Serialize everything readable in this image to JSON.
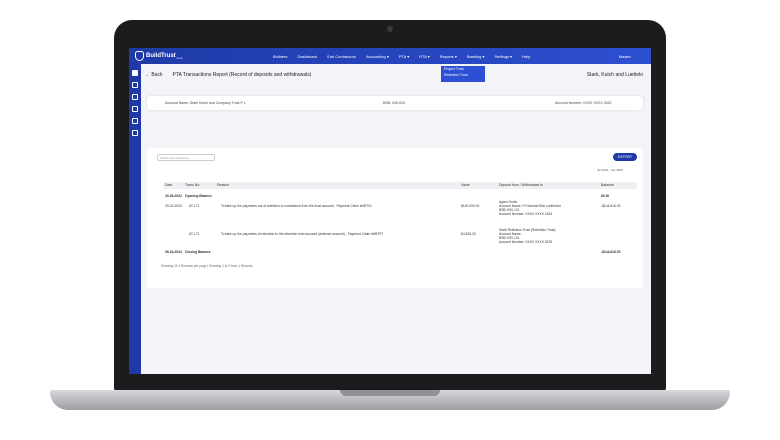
{
  "app": {
    "logo_text": "BuildTrust",
    "logo_sub": "beta",
    "nav": [
      "Builders",
      "Dashboard",
      "Sub Contractors",
      "Accounting ▾",
      "PTA ▾",
      "RTA ▾",
      "Reports ▾",
      "Banking ▾",
      "Settings ▾",
      "Help"
    ],
    "user": "Master"
  },
  "dropdown": [
    "Project Trust",
    "Retention Trust"
  ],
  "page": {
    "back": "← Back",
    "title": "PTA Transactions Report (Record of deposits and withdrawals)",
    "company": "Stark, Kutch and Luettelo"
  },
  "account": {
    "name": "Account Name: Stark Kutch and Company Trust P L",
    "bsb": "BSB: 000-034",
    "number": "Account Number: XXXX XXXX 3432"
  },
  "controls": {
    "select_placeholder": "Select Sub Contractor",
    "export": "EXPORT",
    "date_range": "Jul 2022 - Apr 2024"
  },
  "table": {
    "headers": [
      "Date",
      "Trans No.",
      "Reason",
      "Value",
      "Deposit from / Withdrawal to",
      "Balance"
    ],
    "opening": {
      "date": "30-06-2022",
      "label": "Opening Balance",
      "balance": "$0.00"
    },
    "rows": [
      {
        "date": "20-02-2024",
        "trans": "AT-171",
        "reason": "To take up the payments out of retention to contractors from the trust account - Payment Claim #HBT01",
        "value": "$140,000.00",
        "party": [
          "Agrex Dorito",
          "Account Name: FY/Jannah Bob confirmed",
          "BSB: 000-121",
          "Account Number: XXXX XXXX 4343"
        ],
        "balance": "-$144,816.30"
      },
      {
        "date": "",
        "trans": "AT-171",
        "reason": "To take up the payments of retention to the retention trust account (deferred account) - Payment Claim #HBT97",
        "value": "$4,816.30",
        "party": [
          "Stark Retention Trust (Retention Trust)",
          "Account Name:",
          "BSB: 000-131",
          "Account Number: XXXX XXXX 5378"
        ],
        "balance": ""
      }
    ],
    "closing": {
      "date": "06-04-2024",
      "label": "Closing Balance",
      "balance": "-$144,816.30"
    }
  },
  "footer": "Showing 10 ▾ Records per page | Showing 1 to 3 from 1 Records"
}
